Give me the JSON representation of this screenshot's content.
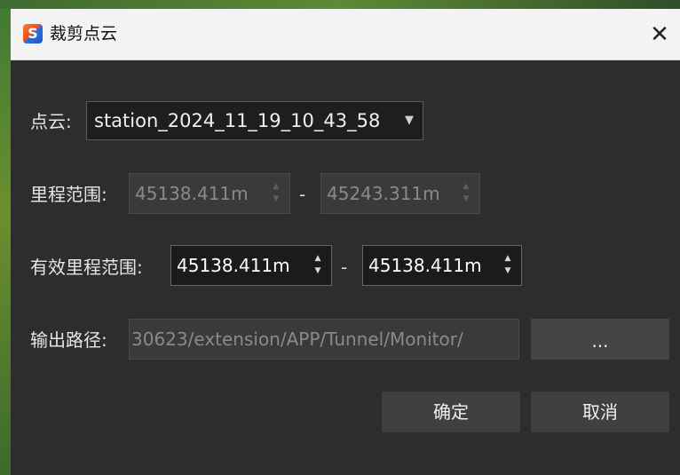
{
  "window": {
    "title": "裁剪点云",
    "icon_letter": "S",
    "close_glyph": "✕"
  },
  "form": {
    "point_cloud": {
      "label": "点云:",
      "selected": "station_2024_11_19_10_43_58",
      "arrow": "▼"
    },
    "mileage_range": {
      "label": "里程范围:",
      "from": "45138.411m",
      "to": "45243.311m",
      "separator": "-",
      "enabled": false
    },
    "valid_mileage_range": {
      "label": "有效里程范围:",
      "from": "45138.411m",
      "to": "45138.411m",
      "separator": "-",
      "enabled": true
    },
    "output_path": {
      "label": "输出路径:",
      "value": "30623/extension/APP/Tunnel/Monitor/",
      "browse_label": "..."
    }
  },
  "buttons": {
    "ok": "确定",
    "cancel": "取消"
  },
  "spin_arrows": {
    "up": "▲",
    "down": "▼"
  }
}
